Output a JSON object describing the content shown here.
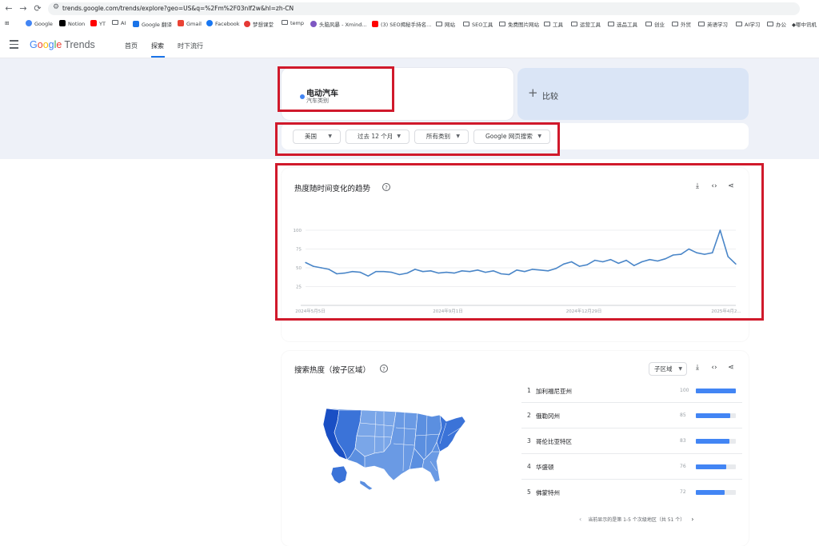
{
  "browser": {
    "url": "trends.google.com/trends/explore?geo=US&q=%2Fm%2F03nlf2w&hl=zh-CN",
    "bookmarks": [
      {
        "label": "Google",
        "color": "#4285f4"
      },
      {
        "label": "Notion",
        "color": "#000000"
      },
      {
        "label": "YT",
        "color": "#ff0000"
      },
      {
        "label": "AI",
        "color": "",
        "folder": true
      },
      {
        "label": "Google 翻译",
        "color": "#1a73e8"
      },
      {
        "label": "Gmail",
        "color": "#ea4335"
      },
      {
        "label": "Facebook",
        "color": "#1877f2"
      },
      {
        "label": "梦想课堂",
        "color": "#e53935"
      },
      {
        "label": "temp",
        "color": "",
        "folder": true
      },
      {
        "label": "头脑风暴 - Xmind...",
        "color": "#7e57c2"
      },
      {
        "label": "(3) SEO揭秘手持名...",
        "color": "#ff0000"
      },
      {
        "label": "网站",
        "color": "",
        "folder": true
      },
      {
        "label": "SEO工具",
        "color": "",
        "folder": true
      },
      {
        "label": "免费图片网站",
        "color": "",
        "folder": true
      },
      {
        "label": "工具",
        "color": "",
        "folder": true
      },
      {
        "label": "运营工具",
        "color": "",
        "folder": true
      },
      {
        "label": "选品工具",
        "color": "",
        "folder": true
      },
      {
        "label": "创业",
        "color": "",
        "folder": true
      },
      {
        "label": "外贸",
        "color": "",
        "folder": true
      },
      {
        "label": "英语学习",
        "color": "",
        "folder": true
      },
      {
        "label": "AI学习",
        "color": "",
        "folder": true
      },
      {
        "label": "办公",
        "color": "",
        "folder": true
      },
      {
        "label": "哪中讯机",
        "color": "#3c4043"
      }
    ]
  },
  "header": {
    "logo_google": "Google",
    "logo_trends": "Trends",
    "tabs": [
      "首页",
      "探索",
      "时下流行"
    ],
    "active_tab": "探索"
  },
  "search_term": {
    "name": "电动汽车",
    "category": "汽车类别",
    "dot_color": "#4285f4"
  },
  "compare": {
    "label": "比较"
  },
  "filters": {
    "region": "美国",
    "time_range": "过去 12 个月",
    "category": "所有类别",
    "search_type": "Google 网页搜索"
  },
  "trend_section": {
    "title": "热度随时间变化的趋势"
  },
  "chart_data": {
    "type": "line",
    "x_tick_labels": [
      "2024年5月5日",
      "2024年9月1日",
      "2024年12月29日",
      "2025年4月2..."
    ],
    "y_ticks": [
      25,
      50,
      75,
      100
    ],
    "ylim": [
      0,
      100
    ],
    "grid": true,
    "color": "#4a86c8",
    "values": [
      57,
      52,
      50,
      48,
      42,
      43,
      45,
      44,
      39,
      45,
      45,
      44,
      41,
      43,
      48,
      45,
      46,
      43,
      44,
      43,
      46,
      45,
      47,
      44,
      46,
      42,
      41,
      47,
      45,
      48,
      47,
      46,
      49,
      55,
      58,
      52,
      54,
      60,
      58,
      61,
      56,
      60,
      53,
      58,
      61,
      59,
      62,
      67,
      68,
      75,
      70,
      68,
      70,
      100,
      65,
      55
    ]
  },
  "region_section": {
    "title": "搜索热度（按子区域）",
    "subregion_label": "子区域",
    "rankings": [
      {
        "rank": "1",
        "name": "加利福尼亚州",
        "value": 100
      },
      {
        "rank": "2",
        "name": "俄勒冈州",
        "value": 85
      },
      {
        "rank": "3",
        "name": "哥伦比亚特区",
        "value": 83
      },
      {
        "rank": "4",
        "name": "华盛顿",
        "value": 76
      },
      {
        "rank": "5",
        "name": "佛蒙特州",
        "value": 72
      }
    ],
    "pagination": "当前显示的是第 1-5 个次级地区（共 51 个）"
  },
  "map": {
    "colors": {
      "dark": "#1a4fc4",
      "mid": "#3b73d8",
      "light": "#5b8fe0",
      "pale": "#7aa6e8"
    }
  }
}
